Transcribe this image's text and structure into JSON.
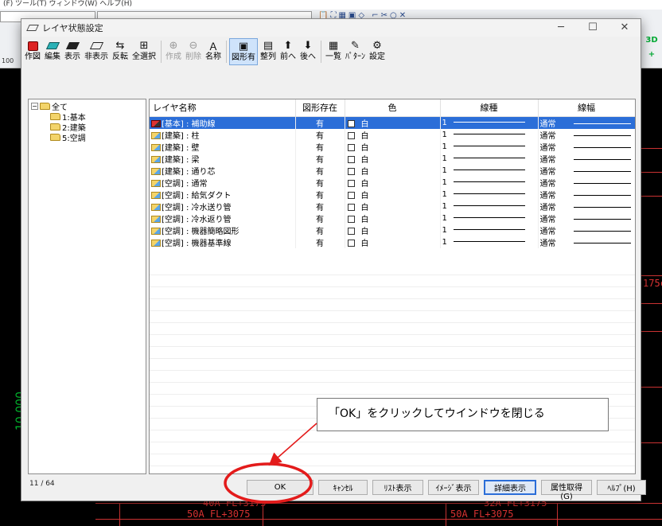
{
  "background": {
    "menubar": "(F)   ツール(T)   ウィンドウ(W)   ヘルプ(H)",
    "toolbar_strip": "📋⛶▦▣◇ ⌐✂○✕",
    "zoom_text": "100",
    "right_labels": [
      "3D",
      "+"
    ],
    "dimension_text": "10,000",
    "cad_labels": {
      "label_175": "175c",
      "label_40a": "40A  FL+3175",
      "label_50a": "50A  FL+3075",
      "label_32a": "32A  FL+3175",
      "label_50a_right": "50A  FL+3075"
    }
  },
  "dialog": {
    "title": "レイヤ状態設定",
    "window_buttons": {
      "minimize": "─",
      "maximize": "☐",
      "close": "✕"
    },
    "toolbar": [
      {
        "id": "create",
        "label": "作図",
        "icon": "create-icon"
      },
      {
        "id": "edit",
        "label": "編集",
        "icon": "edit-icon"
      },
      {
        "id": "show",
        "label": "表示",
        "icon": "show-icon"
      },
      {
        "id": "hide",
        "label": "非表示",
        "icon": "hide-icon"
      },
      {
        "id": "invert",
        "label": "反転",
        "icon": "invert-icon"
      },
      {
        "id": "select-all",
        "label": "全選択",
        "icon": "select-all-icon"
      },
      {
        "id": "new",
        "label": "作成",
        "icon": "new-layer-icon",
        "disabled": true
      },
      {
        "id": "delete",
        "label": "削除",
        "icon": "delete-icon",
        "disabled": true
      },
      {
        "id": "rename",
        "label": "名称",
        "icon": "rename-icon"
      },
      {
        "id": "has-shape",
        "label": "図形有",
        "icon": "has-shape-icon",
        "pressed": true
      },
      {
        "id": "arrange",
        "label": "整列",
        "icon": "arrange-icon"
      },
      {
        "id": "forward",
        "label": "前へ",
        "icon": "arrow-up-icon"
      },
      {
        "id": "backward",
        "label": "後へ",
        "icon": "arrow-down-icon"
      },
      {
        "id": "list",
        "label": "一覧",
        "icon": "list-icon"
      },
      {
        "id": "pattern",
        "label": "ﾊﾟﾀｰﾝ",
        "icon": "pattern-icon"
      },
      {
        "id": "settings",
        "label": "設定",
        "icon": "settings-icon"
      }
    ],
    "toolbar_glyphs": {
      "invert": "⇆",
      "select-all": "⊞",
      "new": "⊕",
      "delete": "⊖",
      "rename": "Ａ",
      "has-shape": "▣",
      "arrange": "▤",
      "forward": "⬆",
      "backward": "⬇",
      "list": "▦",
      "pattern": "✎",
      "settings": "⚙"
    },
    "tree": {
      "root": {
        "expander": "−",
        "label": "全て"
      },
      "children": [
        "1:基本",
        "2:建築",
        "5:空調"
      ]
    },
    "columns": [
      "レイヤ名称",
      "図形存在",
      "色",
      "線種",
      "線幅"
    ],
    "rows": [
      {
        "name": "[基本] : 補助線",
        "exists": "有",
        "color": "白",
        "ltype": "1",
        "lwidth": "通常",
        "selected": true,
        "icon": "red"
      },
      {
        "name": "[建築] : 柱",
        "exists": "有",
        "color": "白",
        "ltype": "1",
        "lwidth": "通常"
      },
      {
        "name": "[建築] : 壁",
        "exists": "有",
        "color": "白",
        "ltype": "1",
        "lwidth": "通常"
      },
      {
        "name": "[建築] : 梁",
        "exists": "有",
        "color": "白",
        "ltype": "1",
        "lwidth": "通常"
      },
      {
        "name": "[建築] : 通り芯",
        "exists": "有",
        "color": "白",
        "ltype": "1",
        "lwidth": "通常"
      },
      {
        "name": "[空調] : 通常",
        "exists": "有",
        "color": "白",
        "ltype": "1",
        "lwidth": "通常"
      },
      {
        "name": "[空調] : 給気ダクト",
        "exists": "有",
        "color": "白",
        "ltype": "1",
        "lwidth": "通常"
      },
      {
        "name": "[空調] : 冷水送り管",
        "exists": "有",
        "color": "白",
        "ltype": "1",
        "lwidth": "通常"
      },
      {
        "name": "[空調] : 冷水返り管",
        "exists": "有",
        "color": "白",
        "ltype": "1",
        "lwidth": "通常"
      },
      {
        "name": "[空調] : 機器簡略図形",
        "exists": "有",
        "color": "白",
        "ltype": "1",
        "lwidth": "通常"
      },
      {
        "name": "[空調] : 機器基準線",
        "exists": "有",
        "color": "白",
        "ltype": "1",
        "lwidth": "通常"
      }
    ],
    "status": "11 / 64",
    "buttons": [
      {
        "id": "ok",
        "label": "OK"
      },
      {
        "id": "cancel",
        "label": "ｷｬﾝｾﾙ"
      },
      {
        "id": "list-view",
        "label": "ﾘｽﾄ表示"
      },
      {
        "id": "image-view",
        "label": "ｲﾒｰｼﾞ表示"
      },
      {
        "id": "detail-view",
        "label": "詳細表示",
        "active": true
      },
      {
        "id": "get-attr",
        "label": "属性取得(G)"
      },
      {
        "id": "help",
        "label": "ﾍﾙﾌﾟ(H)"
      }
    ]
  },
  "annotation": {
    "callout_text": "「OK」をクリックしてウインドウを閉じる",
    "color": "#e31b1b"
  }
}
